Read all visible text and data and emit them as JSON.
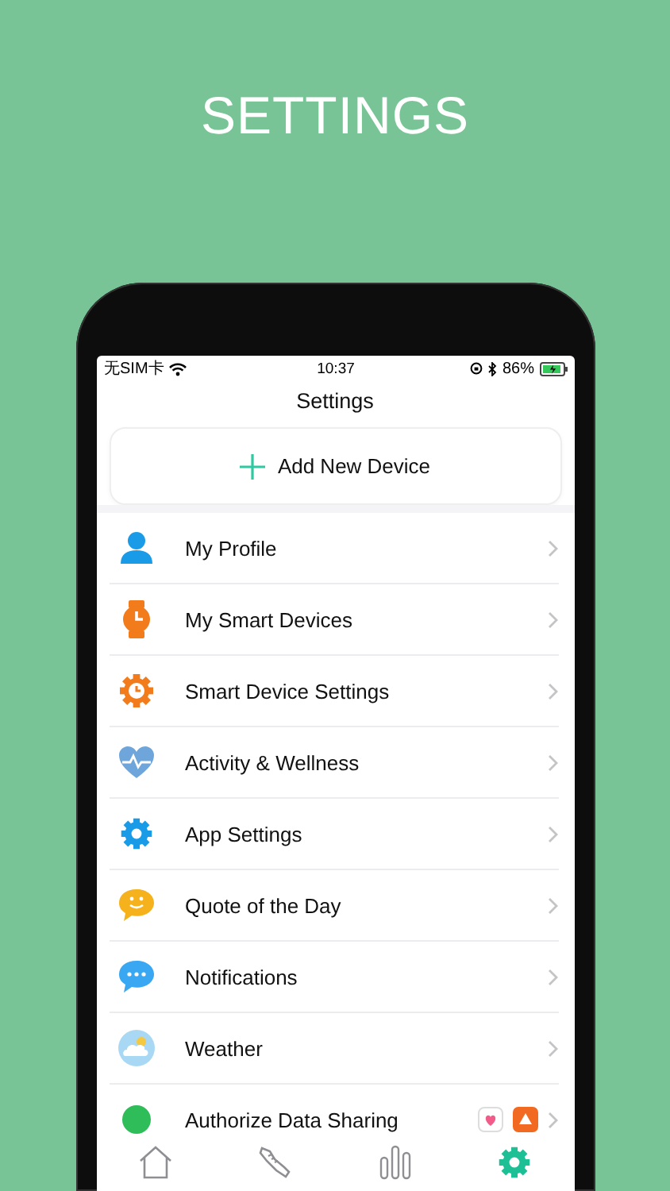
{
  "headline": "SETTINGS",
  "status_bar": {
    "carrier": "无SIM卡",
    "time": "10:37",
    "battery": "86%"
  },
  "screen_title": "Settings",
  "add_button": {
    "label": "Add New Device"
  },
  "menu": [
    {
      "kind": "profile",
      "label": "My Profile"
    },
    {
      "kind": "watch",
      "label": "My Smart Devices"
    },
    {
      "kind": "device-gear",
      "label": "Smart Device Settings"
    },
    {
      "kind": "heart",
      "label": "Activity & Wellness"
    },
    {
      "kind": "gear",
      "label": "App Settings"
    },
    {
      "kind": "quote",
      "label": "Quote of the Day"
    },
    {
      "kind": "chat",
      "label": "Notifications"
    },
    {
      "kind": "weather",
      "label": "Weather"
    },
    {
      "kind": "share",
      "label": "Authorize Data Sharing"
    }
  ],
  "tabs": [
    {
      "kind": "home",
      "selected": false
    },
    {
      "kind": "shoe",
      "selected": false
    },
    {
      "kind": "chart",
      "selected": false
    },
    {
      "kind": "gear",
      "selected": true
    }
  ]
}
